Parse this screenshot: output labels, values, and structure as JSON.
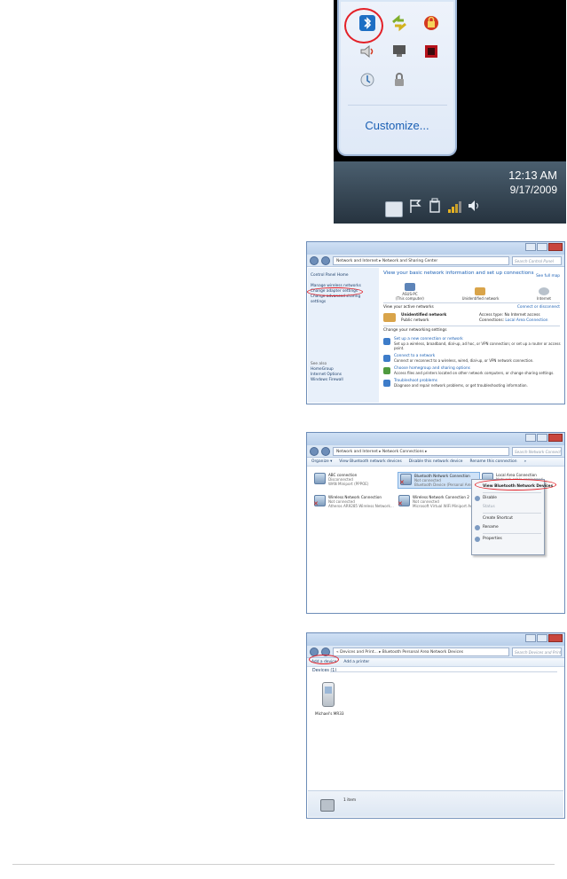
{
  "tray": {
    "customize_label": "Customize...",
    "clock_time": "12:13 AM",
    "clock_date": "9/17/2009"
  },
  "network_sharing_center": {
    "breadcrumb": "Network and Internet  ▸  Network and Sharing Center",
    "search_placeholder": "Search Control Panel",
    "sidebar": {
      "home": "Control Panel Home",
      "links": [
        "Manage wireless networks",
        "Change adapter settings",
        "Change advanced sharing settings"
      ],
      "see_also_title": "See also",
      "see_also": [
        "HomeGroup",
        "Internet Options",
        "Windows Firewall"
      ]
    },
    "heading": "View your basic network information and set up connections",
    "see_full_map": "See full map",
    "map_nodes": [
      {
        "name": "ASUS-PC",
        "sub": "(This computer)"
      },
      {
        "name": "Unidentified network",
        "sub": ""
      },
      {
        "name": "Internet",
        "sub": ""
      }
    ],
    "active_title": "View your active networks",
    "connect_link": "Connect or disconnect",
    "active_network": {
      "name": "Unidentified network",
      "type": "Public network",
      "access_label": "Access type:",
      "access_value": "No Internet access",
      "conn_label": "Connections:",
      "conn_value": "Local Area Connection"
    },
    "change_title": "Change your networking settings",
    "tasks": [
      {
        "title": "Set up a new connection or network",
        "desc": "Set up a wireless, broadband, dial-up, ad hoc, or VPN connection; or set up a router or access point."
      },
      {
        "title": "Connect to a network",
        "desc": "Connect or reconnect to a wireless, wired, dial-up, or VPN network connection."
      },
      {
        "title": "Choose homegroup and sharing options",
        "desc": "Access files and printers located on other network computers, or change sharing settings."
      },
      {
        "title": "Troubleshoot problems",
        "desc": "Diagnose and repair network problems, or get troubleshooting information."
      }
    ]
  },
  "network_connections": {
    "breadcrumb": "Network and Internet  ▸  Network Connections  ▸",
    "search_placeholder": "Search Network Connections",
    "toolbar": [
      "Organize ▾",
      "View Bluetooth network devices",
      "Disable this network device",
      "Rename this connection",
      "»"
    ],
    "items": [
      {
        "name": "ABC connection",
        "status": "Disconnected",
        "device": "WAN Miniport (PPPOE)"
      },
      {
        "name": "Bluetooth Network Connection",
        "status": "Not connected",
        "device": "Bluetooth Device (Personal Area ..."
      },
      {
        "name": "Local Area Connection",
        "status": "Network cable unplugged",
        "device": ""
      },
      {
        "name": "Wireless Network Connection",
        "status": "Not connected",
        "device": "Atheros AR9285 Wireless Network..."
      },
      {
        "name": "Wireless Network Connection 2",
        "status": "Not connected",
        "device": "Microsoft Virtual WiFi Miniport Ad..."
      }
    ],
    "context_menu": [
      "View Bluetooth Network Devices",
      "Disable",
      "Status",
      "Create Shortcut",
      "Rename",
      "Properties"
    ]
  },
  "devices": {
    "breadcrumb": "«  Devices and Print...  ▸  Bluetooth Personal Area Network Devices",
    "search_placeholder": "Search Devices and Printers",
    "toolbar": [
      "Add a device",
      "Add a printer"
    ],
    "group_label": "Devices (1)",
    "device_name": "Michael's MR33",
    "item_count": "1 item"
  }
}
